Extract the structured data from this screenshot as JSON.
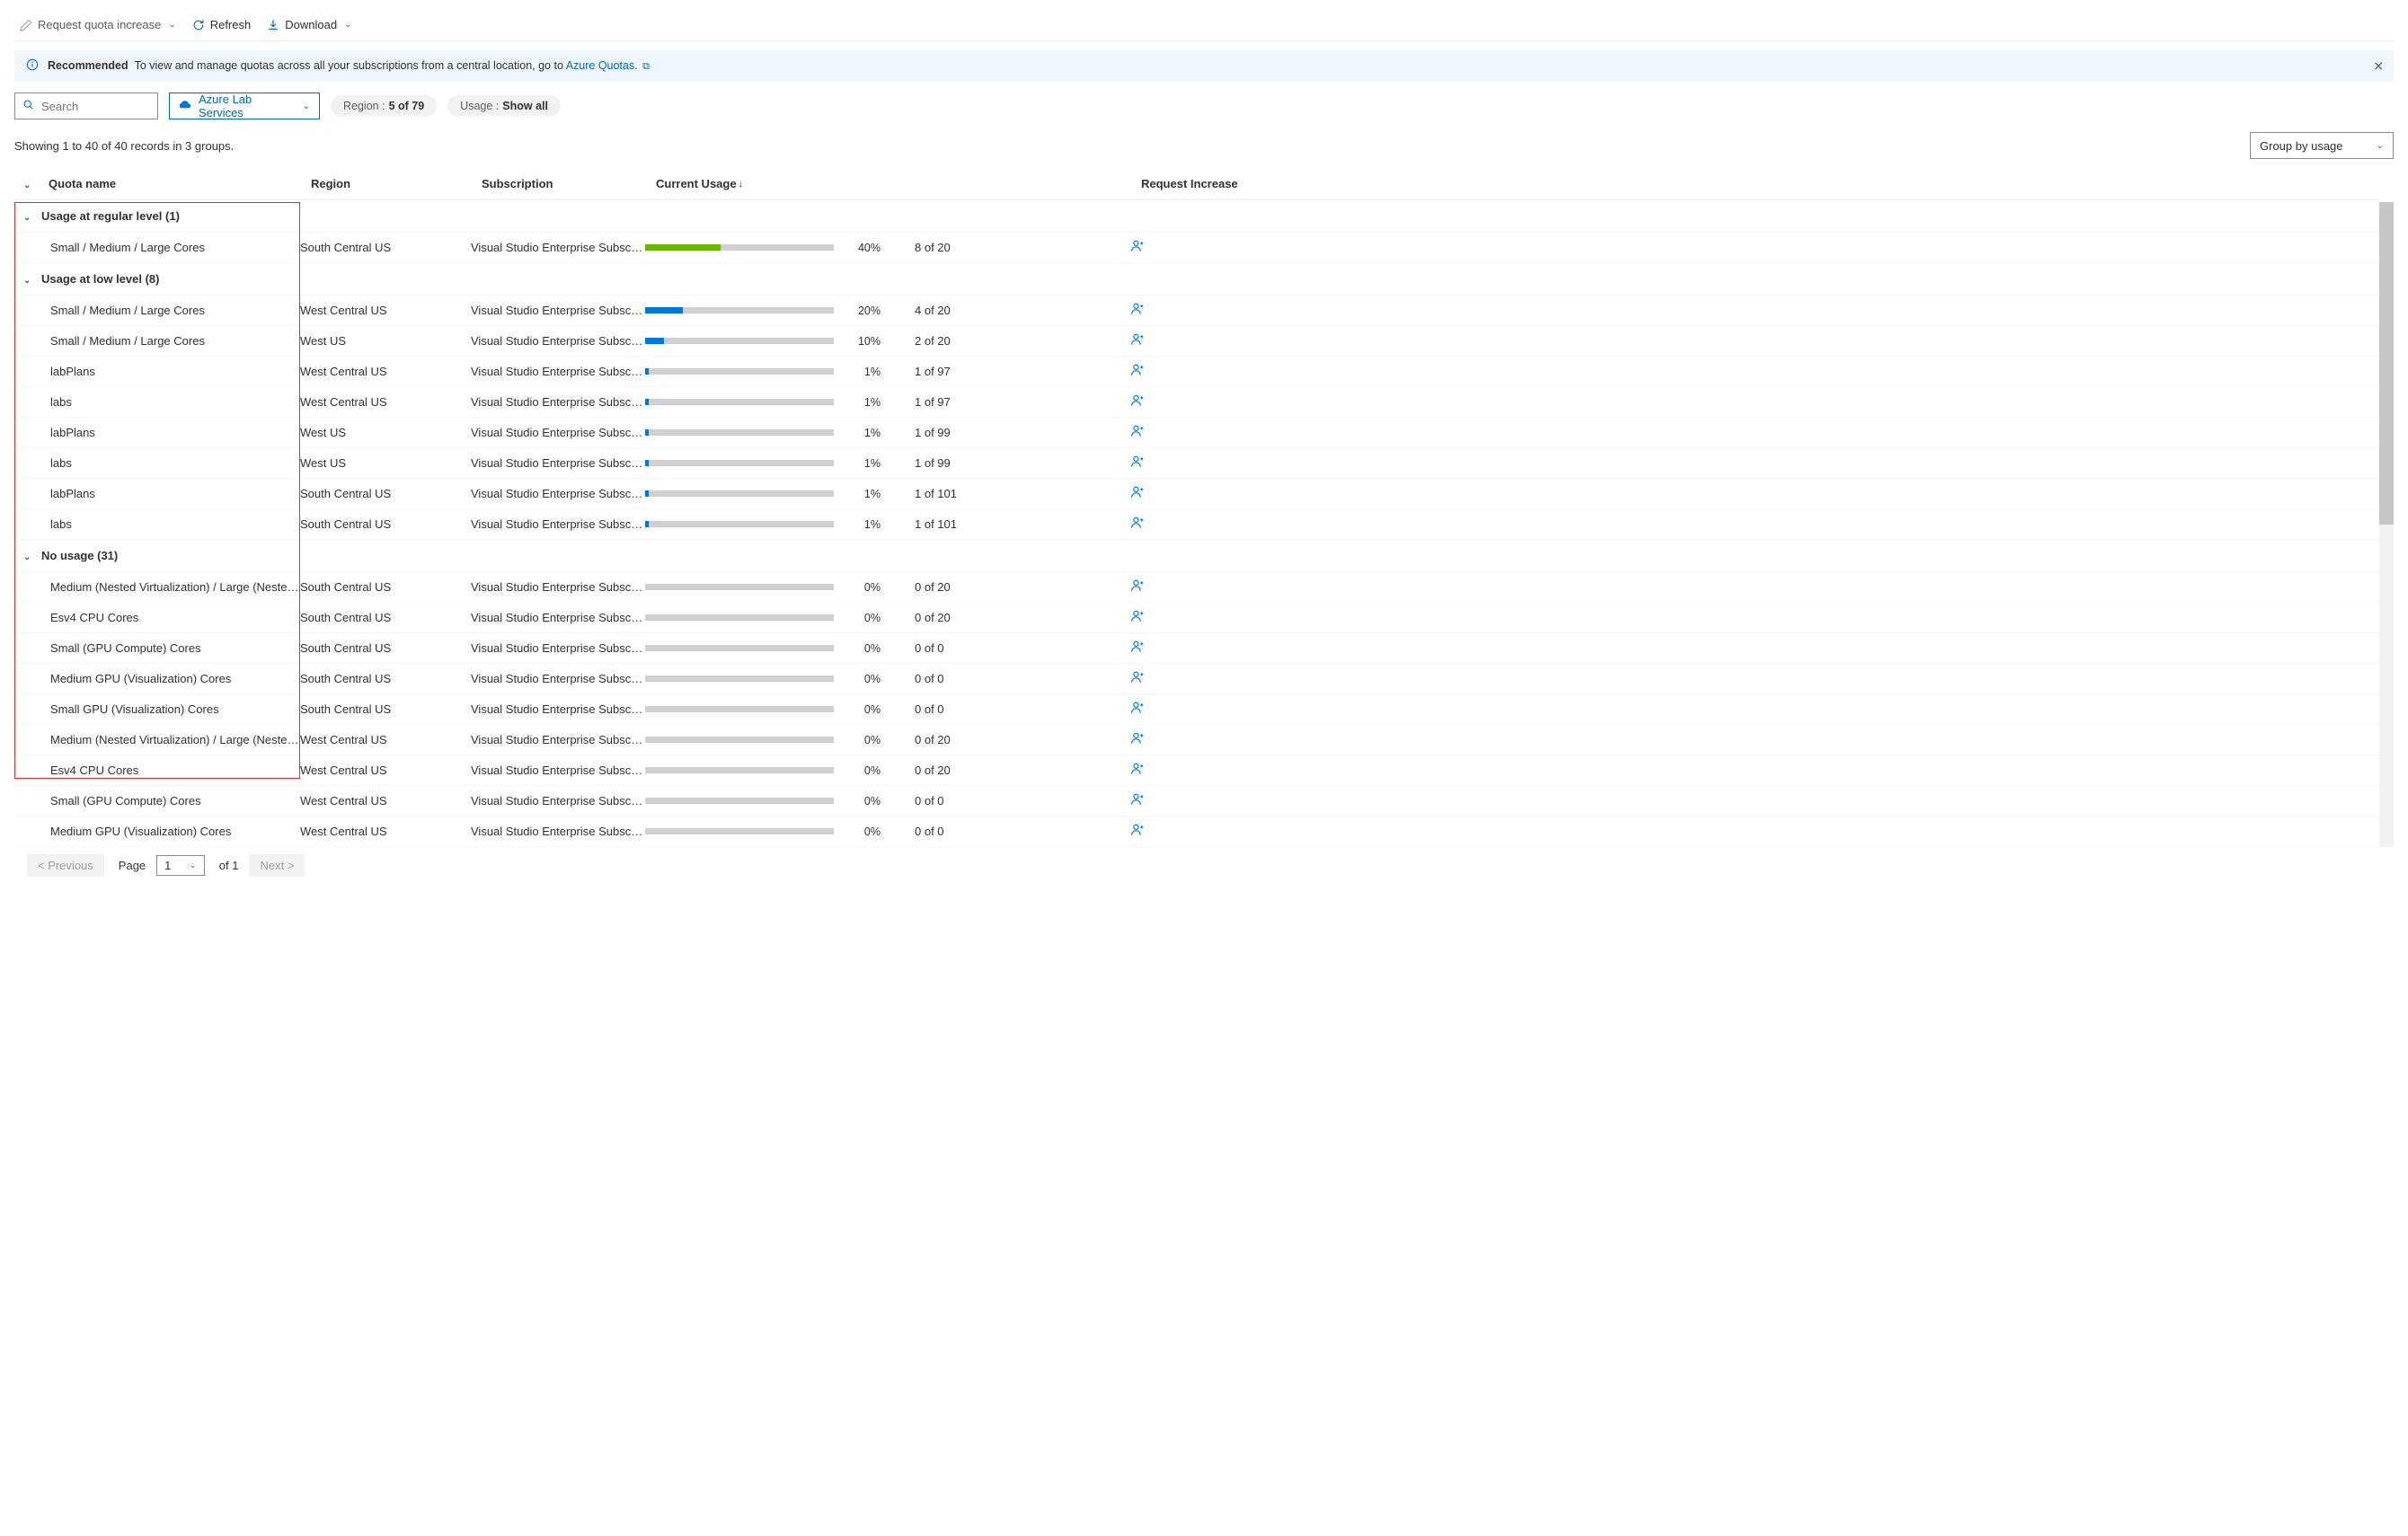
{
  "toolbar": {
    "request_increase": "Request quota increase",
    "refresh": "Refresh",
    "download": "Download"
  },
  "banner": {
    "recommended": "Recommended",
    "text": "To view and manage quotas across all your subscriptions from a central location, go to ",
    "link": "Azure Quotas."
  },
  "search": {
    "placeholder": "Search"
  },
  "provider": {
    "label": "Azure Lab Services"
  },
  "filters": {
    "region_label": "Region : ",
    "region_value": "5 of 79",
    "usage_label": "Usage : ",
    "usage_value": "Show all"
  },
  "summary": "Showing 1 to 40 of 40 records in 3 groups.",
  "group_by": "Group by usage",
  "columns": {
    "quota": "Quota name",
    "region": "Region",
    "subscription": "Subscription",
    "usage": "Current Usage",
    "request": "Request Increase"
  },
  "groups": [
    {
      "label": "Usage at regular level (1)",
      "rows": [
        {
          "name": "Small / Medium / Large Cores",
          "region": "South Central US",
          "sub": "Visual Studio Enterprise Subscri…",
          "pct": 40,
          "val": "8 of 20",
          "color": "green"
        }
      ]
    },
    {
      "label": "Usage at low level (8)",
      "rows": [
        {
          "name": "Small / Medium / Large Cores",
          "region": "West Central US",
          "sub": "Visual Studio Enterprise Subscri…",
          "pct": 20,
          "val": "4 of 20",
          "color": "blue"
        },
        {
          "name": "Small / Medium / Large Cores",
          "region": "West US",
          "sub": "Visual Studio Enterprise Subscri…",
          "pct": 10,
          "val": "2 of 20",
          "color": "blue"
        },
        {
          "name": "labPlans",
          "region": "West Central US",
          "sub": "Visual Studio Enterprise Subscri…",
          "pct": 1,
          "val": "1 of 97",
          "color": "blue"
        },
        {
          "name": "labs",
          "region": "West Central US",
          "sub": "Visual Studio Enterprise Subscri…",
          "pct": 1,
          "val": "1 of 97",
          "color": "blue"
        },
        {
          "name": "labPlans",
          "region": "West US",
          "sub": "Visual Studio Enterprise Subscri…",
          "pct": 1,
          "val": "1 of 99",
          "color": "blue"
        },
        {
          "name": "labs",
          "region": "West US",
          "sub": "Visual Studio Enterprise Subscri…",
          "pct": 1,
          "val": "1 of 99",
          "color": "blue"
        },
        {
          "name": "labPlans",
          "region": "South Central US",
          "sub": "Visual Studio Enterprise Subscri…",
          "pct": 1,
          "val": "1 of 101",
          "color": "blue"
        },
        {
          "name": "labs",
          "region": "South Central US",
          "sub": "Visual Studio Enterprise Subscri…",
          "pct": 1,
          "val": "1 of 101",
          "color": "blue"
        }
      ]
    },
    {
      "label": "No usage (31)",
      "rows": [
        {
          "name": "Medium (Nested Virtualization) / Large (Nested …",
          "region": "South Central US",
          "sub": "Visual Studio Enterprise Subscri…",
          "pct": 0,
          "val": "0 of 20",
          "color": "blue"
        },
        {
          "name": "Esv4 CPU Cores",
          "region": "South Central US",
          "sub": "Visual Studio Enterprise Subscri…",
          "pct": 0,
          "val": "0 of 20",
          "color": "blue"
        },
        {
          "name": "Small (GPU Compute) Cores",
          "region": "South Central US",
          "sub": "Visual Studio Enterprise Subscri…",
          "pct": 0,
          "val": "0 of 0",
          "color": "blue"
        },
        {
          "name": "Medium GPU (Visualization) Cores",
          "region": "South Central US",
          "sub": "Visual Studio Enterprise Subscri…",
          "pct": 0,
          "val": "0 of 0",
          "color": "blue"
        },
        {
          "name": "Small GPU (Visualization) Cores",
          "region": "South Central US",
          "sub": "Visual Studio Enterprise Subscri…",
          "pct": 0,
          "val": "0 of 0",
          "color": "blue"
        },
        {
          "name": "Medium (Nested Virtualization) / Large (Nested …",
          "region": "West Central US",
          "sub": "Visual Studio Enterprise Subscri…",
          "pct": 0,
          "val": "0 of 20",
          "color": "blue"
        },
        {
          "name": "Esv4 CPU Cores",
          "region": "West Central US",
          "sub": "Visual Studio Enterprise Subscri…",
          "pct": 0,
          "val": "0 of 20",
          "color": "blue"
        },
        {
          "name": "Small (GPU Compute) Cores",
          "region": "West Central US",
          "sub": "Visual Studio Enterprise Subscri…",
          "pct": 0,
          "val": "0 of 0",
          "color": "blue"
        },
        {
          "name": "Medium GPU (Visualization) Cores",
          "region": "West Central US",
          "sub": "Visual Studio Enterprise Subscri…",
          "pct": 0,
          "val": "0 of 0",
          "color": "blue"
        }
      ]
    }
  ],
  "pager": {
    "prev": "< Previous",
    "page_label": "Page",
    "page": "1",
    "of": "of 1",
    "next": "Next >"
  }
}
